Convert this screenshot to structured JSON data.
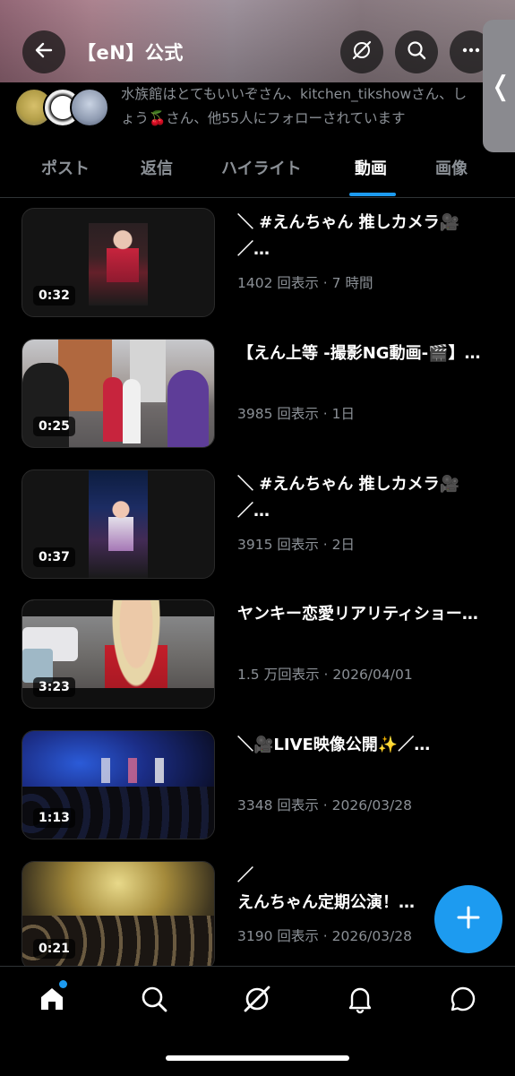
{
  "header": {
    "title": "【eN】公式",
    "back_icon": "arrow-left-icon",
    "explore_icon": "grok-slash-circle-icon",
    "search_icon": "search-icon",
    "more_icon": "more-horizontal-icon",
    "side_pull_glyph": "❬"
  },
  "followers": {
    "text": "水族館はとてもいいぞさん、kitchen_tikshowさん、しょう🍒さん、他55人にフォローされています"
  },
  "tabs": [
    {
      "label": "ポスト",
      "active": false
    },
    {
      "label": "返信",
      "active": false
    },
    {
      "label": "ハイライト",
      "active": false
    },
    {
      "label": "動画",
      "active": true
    },
    {
      "label": "画像",
      "active": false
    }
  ],
  "videos": [
    {
      "duration": "0:32",
      "title": "＼ #えんちゃん 推しカメラ🎥／…",
      "meta": "1402 回表示 · 7 時間"
    },
    {
      "duration": "0:25",
      "title": "【えん上等 -撮影NG動画-🎬】…",
      "meta": "3985 回表示 · 1日"
    },
    {
      "duration": "0:37",
      "title": "＼ #えんちゃん 推しカメラ🎥／…",
      "meta": "3915 回表示 · 2日"
    },
    {
      "duration": "3:23",
      "title": "ヤンキー恋愛リアリティショー…",
      "meta": "1.5 万回表示 · 2026/04/01"
    },
    {
      "duration": "1:13",
      "title": "＼🎥LIVE映像公開✨／…",
      "meta": "3348 回表示 · 2026/03/28"
    },
    {
      "duration": "0:21",
      "title": "／\nえんちゃん定期公演！…",
      "meta": "3190 回表示 · 2026/03/28"
    }
  ],
  "fab": {
    "icon": "plus-icon"
  },
  "bottom_nav": [
    {
      "name": "home",
      "icon": "home-icon",
      "active": true
    },
    {
      "name": "search",
      "icon": "search-icon",
      "active": false
    },
    {
      "name": "grok",
      "icon": "grok-slash-circle-icon",
      "active": false
    },
    {
      "name": "notifications",
      "icon": "bell-icon",
      "active": false
    },
    {
      "name": "messages",
      "icon": "chat-bubble-icon",
      "active": false
    }
  ],
  "colors": {
    "accent": "#1d9bf0",
    "muted_text": "#8b9096",
    "background": "#000000"
  }
}
